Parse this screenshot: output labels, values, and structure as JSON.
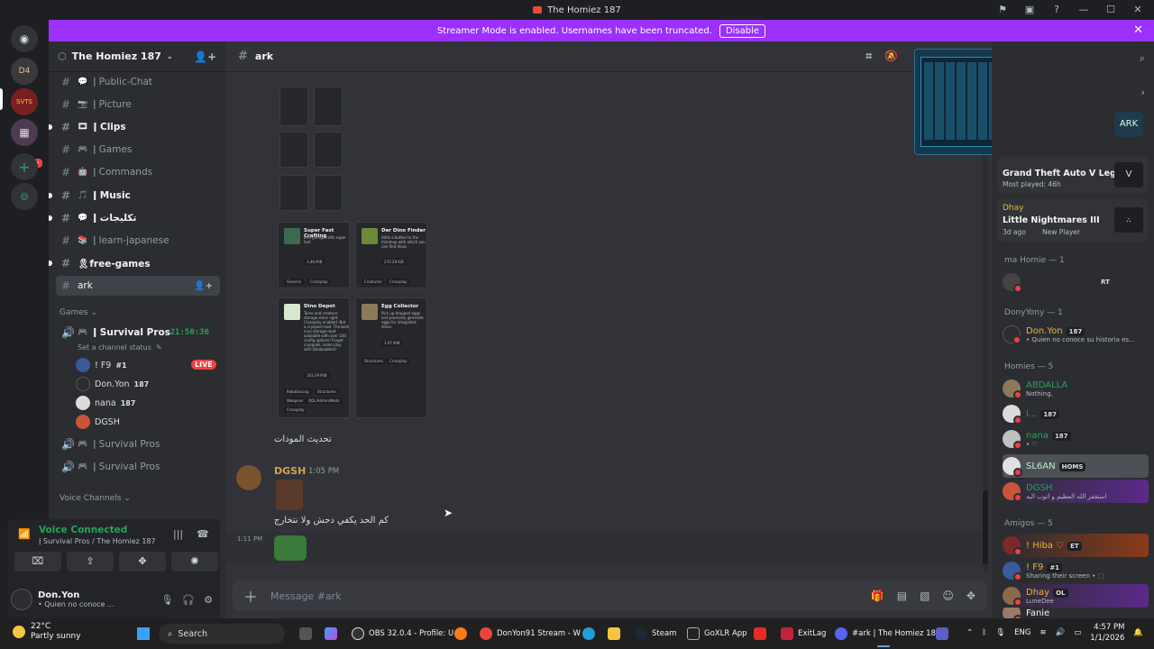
{
  "window": {
    "title": "The Homiez 187"
  },
  "banner": {
    "text": "Streamer Mode is enabled. Usernames have been truncated.",
    "button": "Disable"
  },
  "server": {
    "name": "The Homiez 187",
    "badge": "3K+"
  },
  "channels": [
    {
      "name": "ǀ Public-Chat",
      "emoji": "💬",
      "unread": false
    },
    {
      "name": "ǀ Picture",
      "emoji": "📷",
      "unread": false
    },
    {
      "name": "ǀ Clips",
      "emoji": "🎞",
      "unread": true
    },
    {
      "name": "ǀ Games",
      "emoji": "🎮",
      "unread": false
    },
    {
      "name": "ǀ Commands",
      "emoji": "🤖",
      "unread": false
    },
    {
      "name": "ǀ Music",
      "emoji": "🎵",
      "unread": true
    },
    {
      "name": "ǀ تكليجات",
      "emoji": "💬",
      "unread": true
    },
    {
      "name": "ǀ learn-japanese",
      "emoji": "📚",
      "unread": false
    },
    {
      "name": "🎗free-games",
      "emoji": "",
      "unread": true
    },
    {
      "name": "ark",
      "emoji": "",
      "unread": false,
      "active": true
    }
  ],
  "categories": {
    "games": "Games",
    "voice": "Voice Channels"
  },
  "voice_channels": [
    {
      "name": "ǀ Survival Pros",
      "timer": "21:50:36",
      "status": "Set a channel status"
    },
    {
      "name": "ǀ Survival Pros"
    },
    {
      "name": "ǀ Survival Pros"
    }
  ],
  "voice_users": [
    {
      "name": "! F9",
      "tag": "#1",
      "live": "LIVE"
    },
    {
      "name": "Don.Yon",
      "tag": "187"
    },
    {
      "name": "nana",
      "tag": "187"
    },
    {
      "name": "DGSH",
      "tag": ""
    }
  ],
  "voice_connected": {
    "title": "Voice Connected",
    "sub": "ǀ Survival Pros / The Homiez 187"
  },
  "current_user": {
    "name": "Don.Yon",
    "status": "• Quien no conoce ..."
  },
  "chat": {
    "channel": "ark",
    "cards": [
      {
        "title": "Super Fast Crafting",
        "desc": "Everything crafts super fast",
        "stats": "3.48 MiB",
        "tags": [
          "General",
          "Crossplay"
        ]
      },
      {
        "title": "Der Dino Finder",
        "desc": "Adds a button to the minimap with which you can find dinos",
        "stats": "270.28 KiB",
        "tags": [
          "Creatures",
          "Crossplay"
        ]
      },
      {
        "title": "Dino Depot",
        "desc": "Tame and creature storage since right. Crossplay enabled. Not a cryopod mod. The best cryo storage mod available with over 100 config options! Forget cryopods, come play with Dinobuddies!",
        "stats": "163.39 MiB",
        "tags": [
          "Rebalancing",
          "Structures",
          "Weapons",
          "QOL/Admin/Mods",
          "Crossplay"
        ]
      },
      {
        "title": "Egg Collector",
        "desc": "Pick up dropped eggs and passively generate eggs for integrated dinos.",
        "stats": "3.97 MiB",
        "tags": [
          "Structures",
          "Crossplay"
        ]
      }
    ],
    "message1": "تحديث المودات",
    "author": "DGSH",
    "time": "1:05 PM",
    "message2": "كم الحد يكفي دحش ولا نتخارج",
    "time2": "1:11 PM",
    "input_placeholder": "Message #ark"
  },
  "activities": [
    {
      "game": "Grand Theft Auto V Legacy",
      "sub": "Most played: 46h"
    },
    {
      "user": "Dhay",
      "game": "Little Nightmares III",
      "sub": "3d ago",
      "sub2": "New Player"
    }
  ],
  "member_groups": [
    {
      "label": "ma Homie — 1",
      "members": [
        {
          "name": "",
          "sub": "",
          "tag": "RT"
        }
      ]
    },
    {
      "label": "DonyYony — 1",
      "members": [
        {
          "name": "Don.Yon",
          "sub": "• Quien no conoce su historia es...",
          "tag": "187"
        }
      ]
    },
    {
      "label": "Homies — 5",
      "members": [
        {
          "name": "ABDALLA",
          "sub": "Nothing,",
          "tag": ""
        },
        {
          "name": "i...",
          "sub": "",
          "tag": "187"
        },
        {
          "name": "nana",
          "sub": "• ♡",
          "tag": "187"
        },
        {
          "name": "SL6AN",
          "sub": "",
          "tag": "HOMS"
        },
        {
          "name": "DGSH",
          "sub": "استغفر الله العظيم و اتوب اليه",
          "tag": ""
        }
      ]
    },
    {
      "label": "Amigos — 5",
      "members": [
        {
          "name": "! Hiba ♡",
          "sub": "",
          "tag": "ET"
        },
        {
          "name": "! F9",
          "sub": "Sharing their screen • ⬚",
          "tag": "#1"
        },
        {
          "name": "Dhay",
          "sub": "LuneDee",
          "tag": "OL"
        },
        {
          "name": "Fanie",
          "sub": "",
          "tag": ""
        }
      ]
    }
  ],
  "taskbar": {
    "weather_temp": "22°C",
    "weather_desc": "Partly sunny",
    "search": "Search",
    "apps": [
      "OBS 32.0.4 - Profile: U",
      "DonYon91 Stream - W",
      "Steam",
      "GoXLR App",
      "ExitLag",
      "#ark | The Homiez 187"
    ],
    "lang": "ENG",
    "time": "4:57 PM",
    "date": "1/1/2026"
  }
}
